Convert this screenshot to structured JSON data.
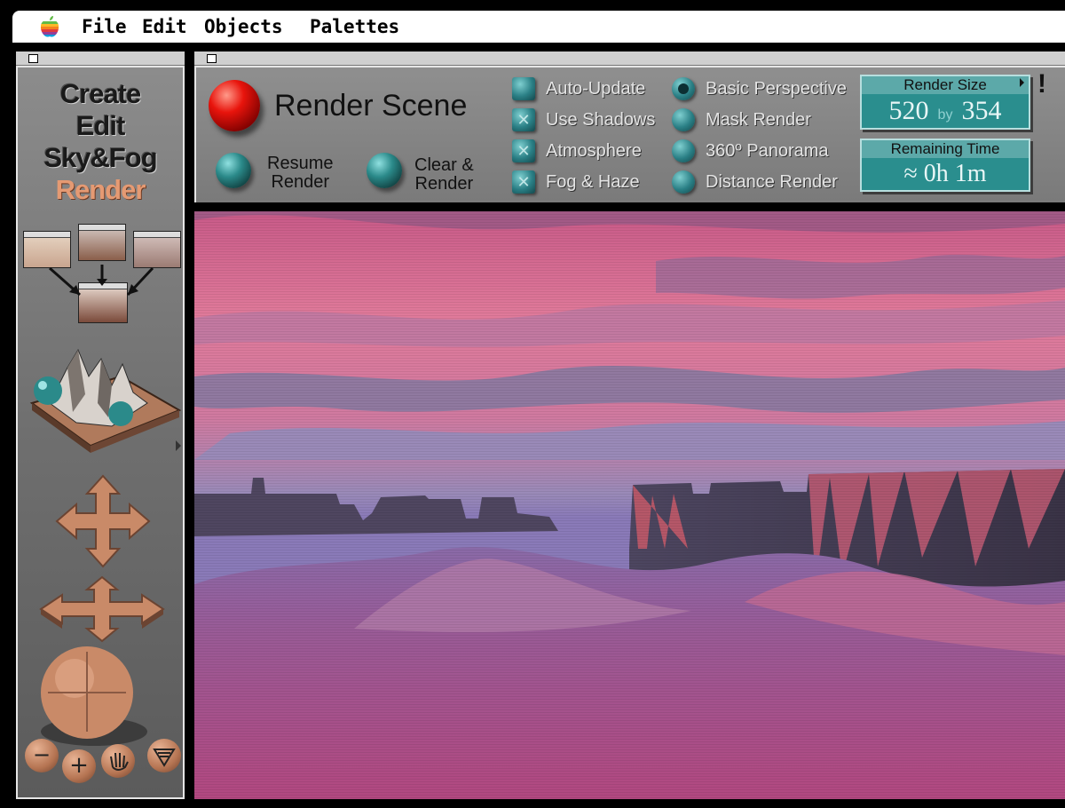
{
  "menubar": {
    "items": [
      "File",
      "Edit",
      "Objects",
      "Palettes"
    ]
  },
  "palette": {
    "modes": [
      {
        "label": "Create",
        "active": false
      },
      {
        "label": "Edit",
        "active": false
      },
      {
        "label": "Sky&Fog",
        "active": false
      },
      {
        "label": "Render",
        "active": true
      }
    ],
    "tools": [
      "move-arrows-vertical",
      "move-arrows-horizontal",
      "trackball",
      "zoom-out",
      "zoom-in",
      "hand",
      "view-fan"
    ],
    "zoom_out_label": "−",
    "zoom_in_label": "+"
  },
  "controls": {
    "render_label": "Render Scene",
    "resume": [
      "Resume",
      "Render"
    ],
    "clear": [
      "Clear &",
      "Render"
    ],
    "checkboxes": [
      {
        "label": "Auto-Update",
        "checked": false
      },
      {
        "label": "Use Shadows",
        "checked": true
      },
      {
        "label": "Atmosphere",
        "checked": true
      },
      {
        "label": "Fog & Haze",
        "checked": true
      }
    ],
    "radios": [
      {
        "label": "Basic Perspective",
        "selected": true
      },
      {
        "label": "Mask Render",
        "selected": false
      },
      {
        "label": "360º Panorama",
        "selected": false
      },
      {
        "label": "Distance Render",
        "selected": false
      }
    ],
    "render_size": {
      "title": "Render Size",
      "width": "520",
      "by": "by",
      "height": "354"
    },
    "remaining": {
      "title": "Remaining Time",
      "value": "≈ 0h 1m"
    },
    "alert": "!"
  },
  "colors": {
    "teal": "#2a8e8e",
    "render_orange": "#e59a73",
    "sky_pink": "#e07a9a",
    "haze_purple": "#8a7ab8"
  }
}
